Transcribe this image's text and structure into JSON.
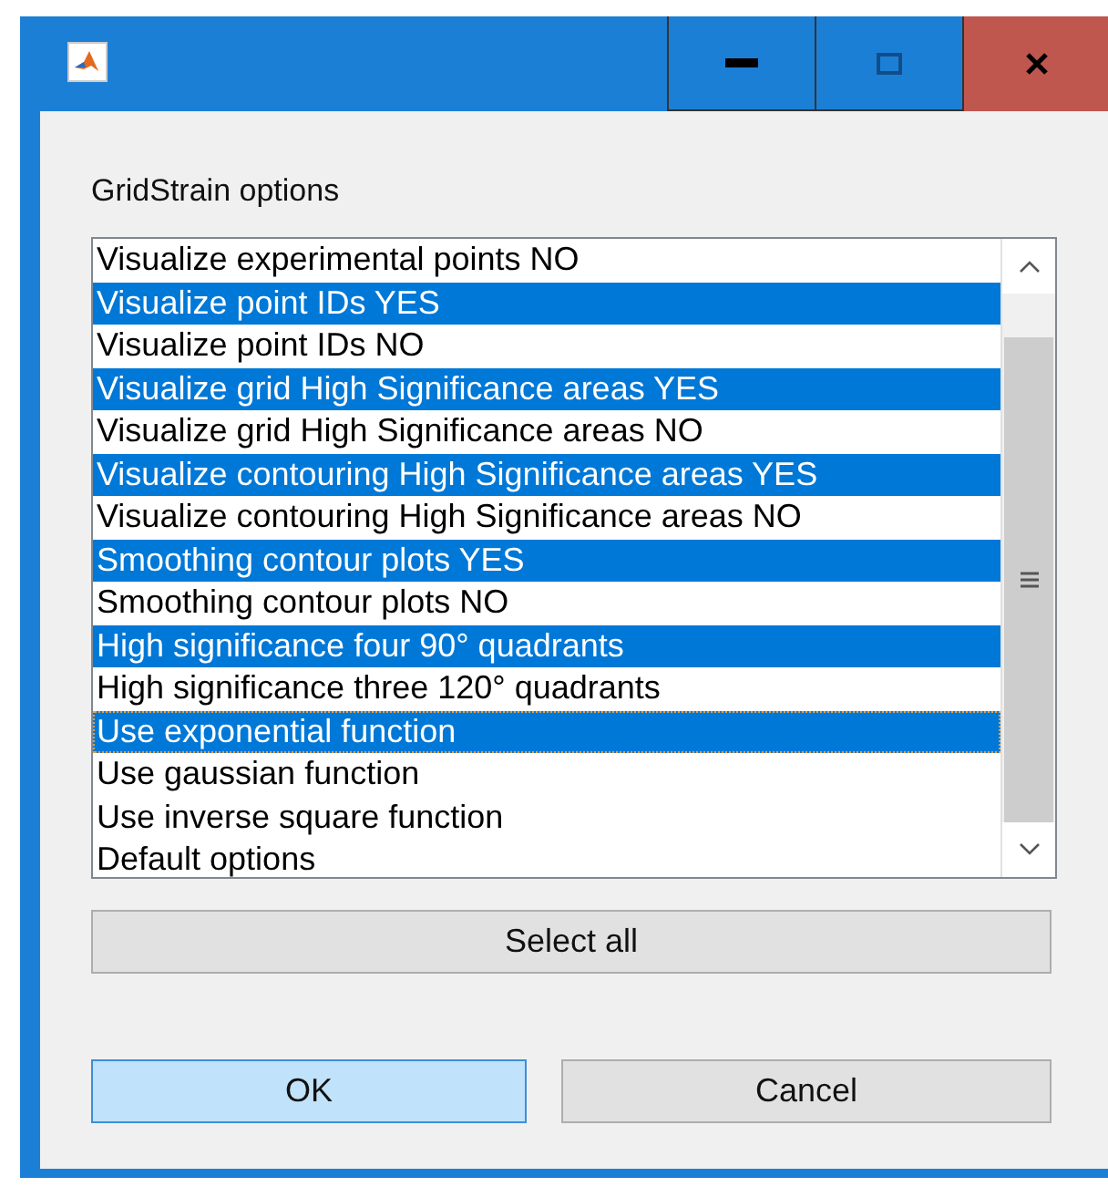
{
  "window": {
    "title_buttons": [
      {
        "kind": "minimize"
      },
      {
        "kind": "maximize"
      },
      {
        "kind": "close"
      }
    ]
  },
  "label": "GridStrain options",
  "options": [
    {
      "text": "Visualize experimental points NO",
      "selected": false,
      "focused": false
    },
    {
      "text": "Visualize point IDs YES",
      "selected": true,
      "focused": false
    },
    {
      "text": "Visualize point IDs NO",
      "selected": false,
      "focused": false
    },
    {
      "text": "Visualize grid High Significance areas YES",
      "selected": true,
      "focused": false
    },
    {
      "text": "Visualize grid High Significance areas NO",
      "selected": false,
      "focused": false
    },
    {
      "text": "Visualize contouring High Significance areas YES",
      "selected": true,
      "focused": false
    },
    {
      "text": "Visualize contouring High Significance areas NO",
      "selected": false,
      "focused": false
    },
    {
      "text": "Smoothing contour plots YES",
      "selected": true,
      "focused": false
    },
    {
      "text": "Smoothing contour plots NO",
      "selected": false,
      "focused": false
    },
    {
      "text": "High significance four 90° quadrants",
      "selected": true,
      "focused": false
    },
    {
      "text": "High significance three 120° quadrants",
      "selected": false,
      "focused": false
    },
    {
      "text": "Use exponential function",
      "selected": true,
      "focused": true
    },
    {
      "text": "Use gaussian function",
      "selected": false,
      "focused": false
    },
    {
      "text": "Use inverse square function",
      "selected": false,
      "focused": false
    },
    {
      "text": "Default options",
      "selected": false,
      "focused": false
    }
  ],
  "select_all_button": "Select all",
  "buttons": [
    {
      "label": "OK",
      "default": true
    },
    {
      "label": "Cancel",
      "default": false
    }
  ]
}
